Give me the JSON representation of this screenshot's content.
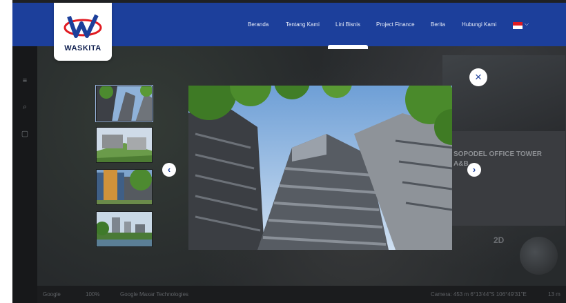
{
  "brand": {
    "logo_text": "WASKITA",
    "primary": "#1c3f9b",
    "accent": "#e11b22"
  },
  "nav": {
    "items": [
      {
        "label": "Beranda"
      },
      {
        "label": "Tentang Kami"
      },
      {
        "label": "Lini Bisnis"
      },
      {
        "label": "Project Finance"
      },
      {
        "label": "Berita"
      },
      {
        "label": "Hubungi Kami"
      }
    ],
    "language_caret": "⌵",
    "active_item": "Lini Bisnis"
  },
  "background": {
    "card_title": "SOPODEL OFFICE TOWER A&B",
    "map_label_2d": "2D",
    "bottom_bar": {
      "google_logo": "Google",
      "zoom": "100%",
      "attribution": "Google  Maxar Technologies",
      "camera": "Camera: 453 m  6°13'44\"S 106°49'31\"E",
      "scale": "13 m"
    }
  },
  "gallery": {
    "close_icon": "×",
    "prev_icon": "‹",
    "next_icon": "›",
    "thumbnails": [
      {
        "name": "thumb-tower-upward",
        "active": true
      },
      {
        "name": "thumb-green-roof"
      },
      {
        "name": "thumb-facade-trees"
      },
      {
        "name": "thumb-skyline-lake"
      }
    ]
  }
}
